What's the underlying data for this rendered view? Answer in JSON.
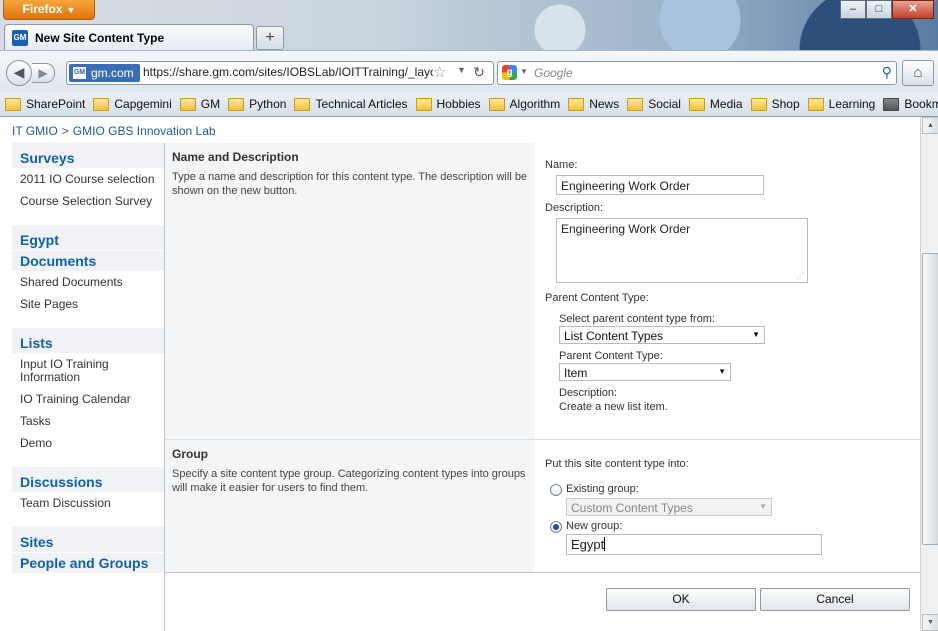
{
  "browser": {
    "app_button": "Firefox",
    "tab_title": "New Site Content Type",
    "favicon_text": "GM",
    "site_identity": "gm.com",
    "url": "https://share.gm.com/sites/IOBSLab/IOITTraining/_layo",
    "search_placeholder": "Google",
    "bookmarks": [
      "SharePoint",
      "Capgemini",
      "GM",
      "Python",
      "Technical Articles",
      "Hobbies",
      "Algorithm",
      "News",
      "Social",
      "Media",
      "Shop",
      "Learning"
    ],
    "bookmarks_menu": "Bookmarks"
  },
  "breadcrumb": {
    "root": "IT GMIO",
    "separator": ">",
    "current": "GMIO GBS Innovation Lab"
  },
  "leftnav": {
    "surveys": {
      "title": "Surveys",
      "items": [
        "2011 IO Course selection",
        "Course Selection Survey"
      ]
    },
    "documents": {
      "title_1": "Egypt",
      "title_2": "Documents",
      "items": [
        "Shared Documents",
        "Site Pages"
      ]
    },
    "lists": {
      "title": "Lists",
      "items": [
        "Input IO Training Information",
        "IO Training Calendar",
        "Tasks",
        "Demo"
      ]
    },
    "discussions": {
      "title": "Discussions",
      "items": [
        "Team Discussion"
      ]
    },
    "sites": "Sites",
    "people": "People and Groups"
  },
  "name_section": {
    "title": "Name and Description",
    "description": "Type a name and description for this content type. The description will be shown on the new button.",
    "name_label": "Name:",
    "name_value": "Engineering Work Order",
    "desc_label": "Description:",
    "desc_value": "Engineering Work Order",
    "parent_label": "Parent Content Type:",
    "select_from_label": "Select parent content type from:",
    "select_from_value": "List Content Types",
    "parent_type_label": "Parent Content Type:",
    "parent_type_value": "Item",
    "parent_desc_label": "Description:",
    "parent_desc_value": "Create a new list item."
  },
  "group_section": {
    "title": "Group",
    "description": "Specify a site content type group. Categorizing content types into groups will make it easier for users to find them.",
    "put_into_label": "Put this site content type into:",
    "existing_label": "Existing group:",
    "existing_value": "Custom Content Types",
    "new_label": "New group:",
    "new_value": "Egypt",
    "selected": "new"
  },
  "buttons": {
    "ok": "OK",
    "cancel": "Cancel"
  }
}
